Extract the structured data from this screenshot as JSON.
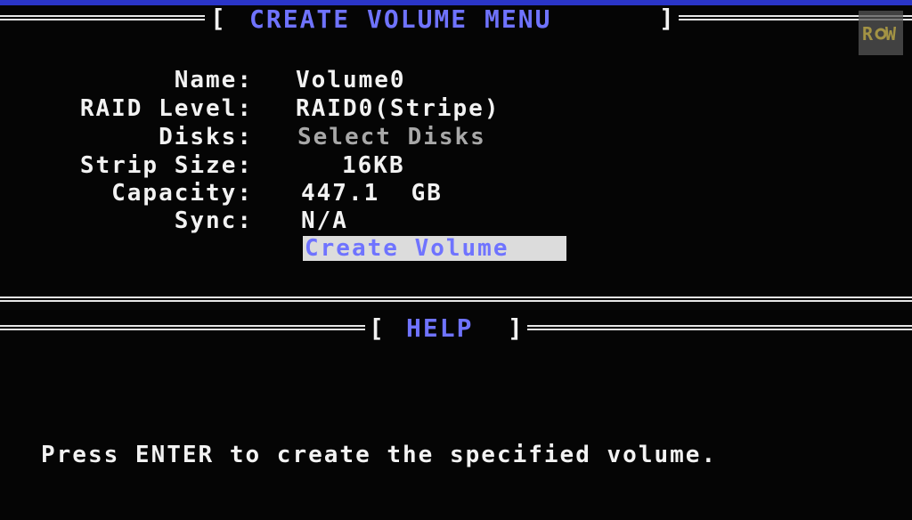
{
  "menu": {
    "title": "CREATE VOLUME MENU",
    "open_bracket": "[",
    "close_bracket": "]"
  },
  "fields": [
    {
      "label": "Name:",
      "value": "Volume0"
    },
    {
      "label": "RAID Level:",
      "value": "RAID0(Stripe)"
    },
    {
      "label": "Disks:",
      "value": "Select Disks"
    },
    {
      "label": "Strip Size:",
      "value": "16KB"
    },
    {
      "label": "Capacity:",
      "value": "447.1  GB"
    },
    {
      "label": "Sync:",
      "value": "N/A"
    }
  ],
  "actions": {
    "create_volume": "Create Volume"
  },
  "help": {
    "title": "HELP",
    "open_bracket": "[",
    "close_bracket": "]",
    "text": "Press ENTER to create the specified volume."
  },
  "colors": {
    "title_blue": "#6f73ff",
    "highlight_bg": "#dcdcdc",
    "background": "#050505"
  },
  "icons": {
    "watermark": "row-logo-icon"
  }
}
